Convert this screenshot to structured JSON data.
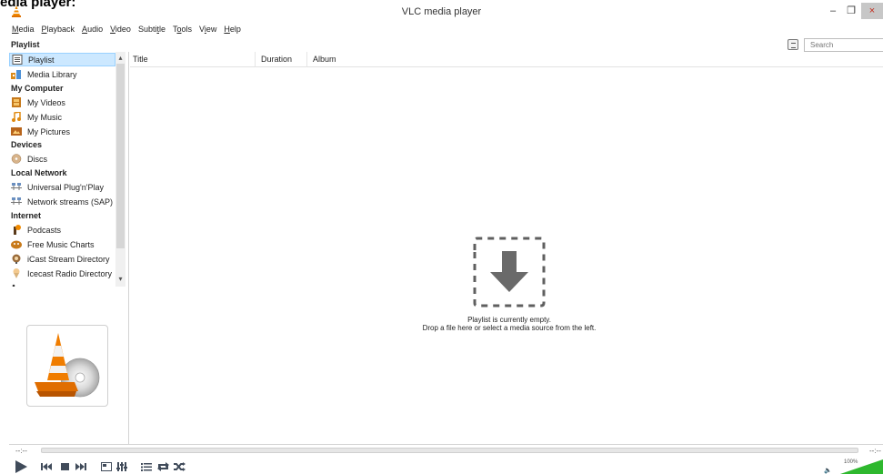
{
  "caption": "edia player:",
  "window": {
    "title": "VLC media player",
    "minimize_glyph": "–",
    "maximize_glyph": "❐",
    "close_glyph": "×"
  },
  "menu": [
    {
      "label": "Media",
      "u": "M",
      "rest": "edia"
    },
    {
      "label": "Playback",
      "u": "P",
      "rest": "layback"
    },
    {
      "label": "Audio",
      "u": "A",
      "rest": "udio"
    },
    {
      "label": "Video",
      "u": "V",
      "rest": "ideo"
    },
    {
      "label": "Subtitle",
      "pre": "Subti",
      "u": "t",
      "rest": "le"
    },
    {
      "label": "Tools",
      "pre": "T",
      "u": "o",
      "rest": "ols"
    },
    {
      "label": "View",
      "pre": "V",
      "u": "i",
      "rest": "ew"
    },
    {
      "label": "Help",
      "u": "H",
      "rest": "elp"
    }
  ],
  "playlist_header": "Playlist",
  "search": {
    "placeholder": "Search"
  },
  "sidebar": {
    "playlist": "Playlist",
    "media_library": "Media Library",
    "cat_my_computer": "My Computer",
    "my_videos": "My Videos",
    "my_music": "My Music",
    "my_pictures": "My Pictures",
    "cat_devices": "Devices",
    "discs": "Discs",
    "cat_local_network": "Local Network",
    "upnp": "Universal Plug'n'Play",
    "sap": "Network streams (SAP)",
    "cat_internet": "Internet",
    "podcasts": "Podcasts",
    "free_music_charts": "Free Music Charts",
    "icast": "iCast Stream Directory",
    "icecast": "Icecast Radio Directory"
  },
  "columns": {
    "title": "Title",
    "duration": "Duration",
    "album": "Album"
  },
  "empty": {
    "line1": "Playlist is currently empty.",
    "line2": "Drop a file here or select a media source from the left."
  },
  "seek": {
    "elapsed": "--:--",
    "remaining": "--:--"
  },
  "volume": {
    "percent_label": "100%",
    "level": 1.0
  },
  "colors": {
    "accent_green": "#2eb82e",
    "selected_bg": "#cce8ff",
    "vlc_orange": "#f08a00"
  }
}
